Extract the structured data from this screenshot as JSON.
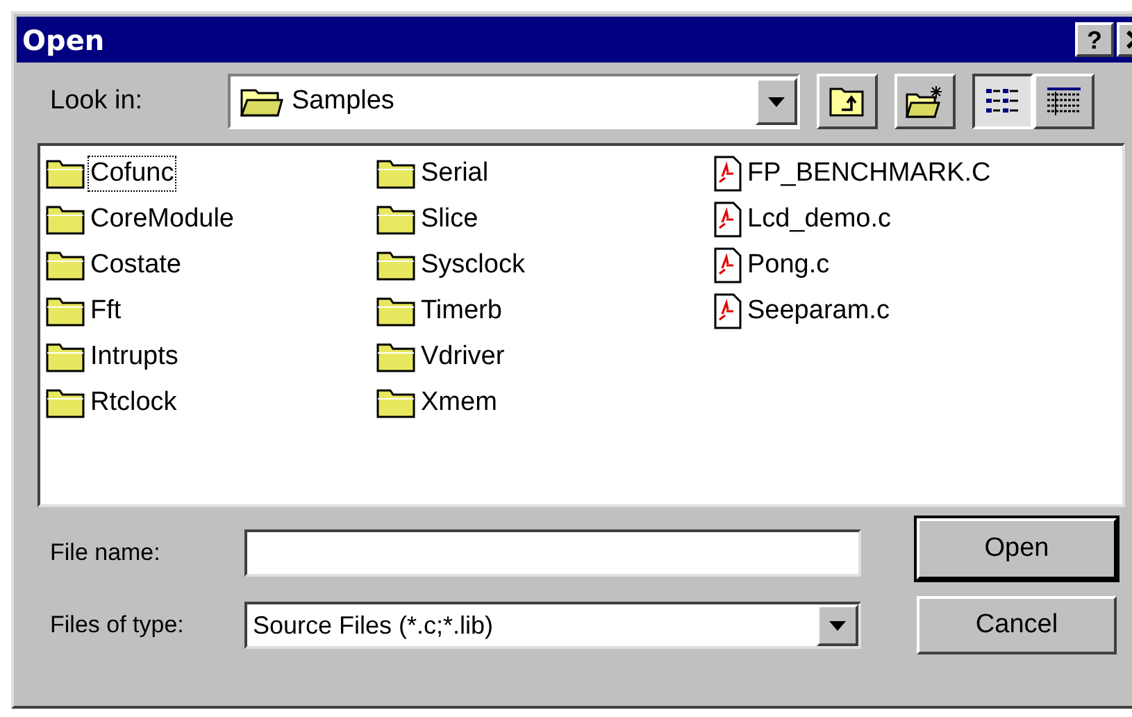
{
  "window": {
    "title": "Open",
    "help": "?"
  },
  "look_in": {
    "label": "Look in:",
    "value": "Samples"
  },
  "toolbar": [
    {
      "kind": "up-folder",
      "selected": false
    },
    {
      "kind": "new-folder",
      "selected": false
    },
    {
      "kind": "list-view",
      "selected": true
    },
    {
      "kind": "details-view",
      "selected": false
    }
  ],
  "files": [
    {
      "name": "Cofunc",
      "kind": "folder",
      "focused": true
    },
    {
      "name": "CoreModule",
      "kind": "folder",
      "focused": false
    },
    {
      "name": "Costate",
      "kind": "folder",
      "focused": false
    },
    {
      "name": "Fft",
      "kind": "folder",
      "focused": false
    },
    {
      "name": "Intrupts",
      "kind": "folder",
      "focused": false
    },
    {
      "name": "Rtclock",
      "kind": "folder",
      "focused": false
    },
    {
      "name": "Serial",
      "kind": "folder",
      "focused": false
    },
    {
      "name": "Slice",
      "kind": "folder",
      "focused": false
    },
    {
      "name": "Sysclock",
      "kind": "folder",
      "focused": false
    },
    {
      "name": "Timerb",
      "kind": "folder",
      "focused": false
    },
    {
      "name": "Vdriver",
      "kind": "folder",
      "focused": false
    },
    {
      "name": "Xmem",
      "kind": "folder",
      "focused": false
    },
    {
      "name": "FP_BENCHMARK.C",
      "kind": "file",
      "focused": false
    },
    {
      "name": "Lcd_demo.c",
      "kind": "file",
      "focused": false
    },
    {
      "name": "Pong.c",
      "kind": "file",
      "focused": false
    },
    {
      "name": "Seeparam.c",
      "kind": "file",
      "focused": false
    }
  ],
  "file_name": {
    "label": "File name:"
  },
  "file_type": {
    "label": "Files of type:",
    "value": "Source Files (*.c;*.lib)"
  },
  "buttons": [
    {
      "label": "Open",
      "default": true
    },
    {
      "label": "Cancel",
      "default": false
    }
  ]
}
